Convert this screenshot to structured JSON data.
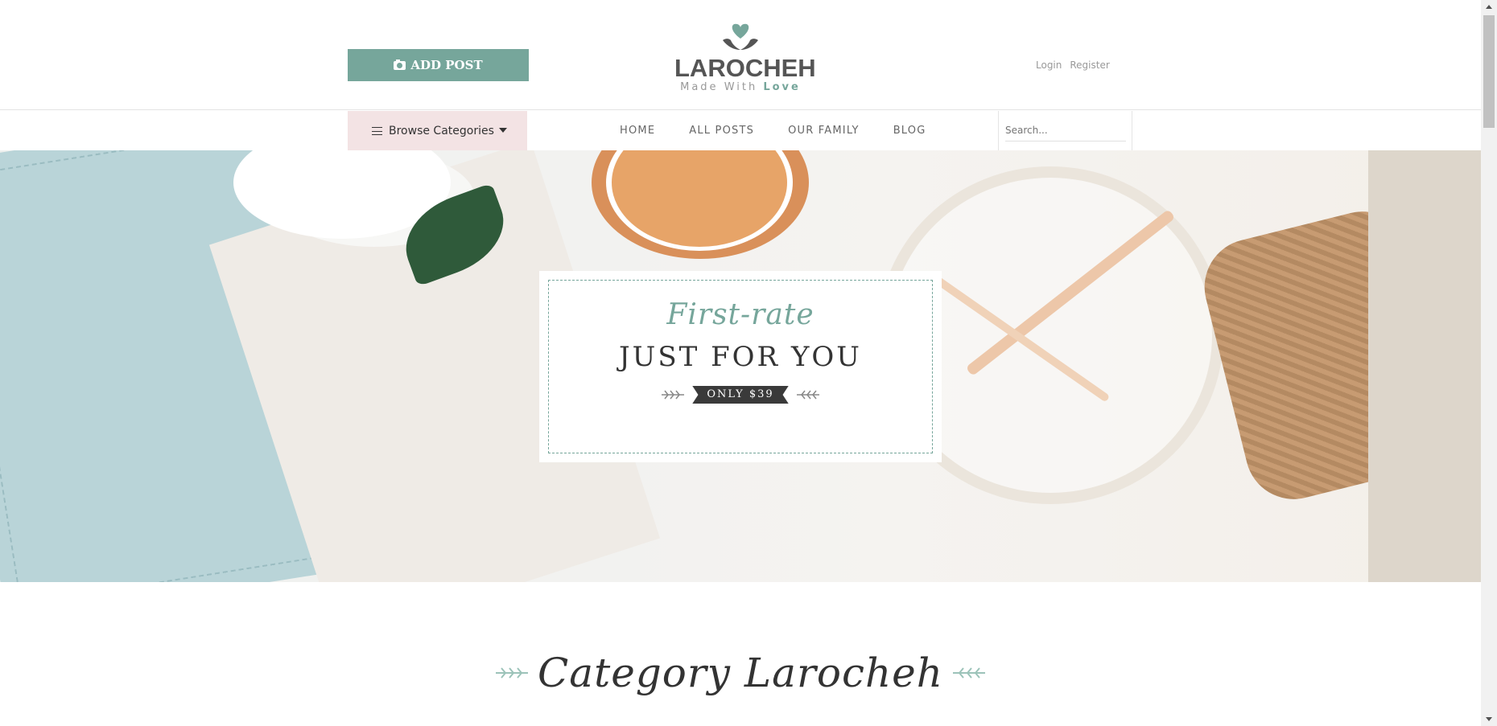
{
  "header": {
    "add_post_label": "ADD POST",
    "logo_name": "LAROCHEH",
    "logo_tag_prefix": "Made With ",
    "logo_tag_emphasis": "Love",
    "login_label": "Login",
    "register_label": "Register"
  },
  "nav": {
    "browse_label": "Browse Categories",
    "items": [
      {
        "label": "HOME"
      },
      {
        "label": "ALL POSTS"
      },
      {
        "label": "OUR FAMILY"
      },
      {
        "label": "BLOG"
      }
    ],
    "search_placeholder": "Search..."
  },
  "hero": {
    "script_text": "First-rate",
    "title": "JUST FOR YOU",
    "price_label": "ONLY $39"
  },
  "section": {
    "title": "Category Larocheh"
  },
  "colors": {
    "accent": "#76a69b",
    "browse_bg": "#f3e3e4",
    "ribbon": "#3a3a3a"
  },
  "icons": {
    "add_post": "camera-icon",
    "browse": "hamburger-icon",
    "browse_dropdown": "caret-down-icon",
    "logo": "heart-hands-icon",
    "decor": "sprig-icon"
  }
}
